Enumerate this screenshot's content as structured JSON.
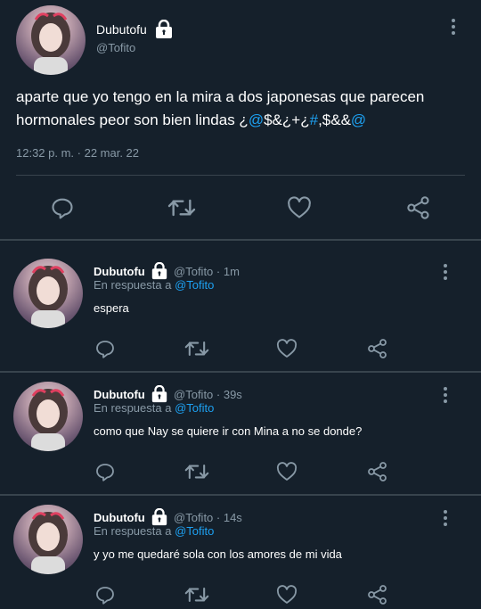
{
  "main_tweet": {
    "name": "Dubutofu",
    "handle": "@Tofito",
    "text_parts": [
      {
        "t": "aparte que yo tengo en la mira a dos japonesas que parecen hormonales peor son bien lindas ¿",
        "link": false
      },
      {
        "t": "@",
        "link": true
      },
      {
        "t": "$&¿+¿",
        "link": false
      },
      {
        "t": "#",
        "link": true
      },
      {
        "t": ",$&&",
        "link": false
      },
      {
        "t": "@",
        "link": true
      }
    ],
    "timestamp": "12:32 p. m. · 22 mar. 22"
  },
  "replies": [
    {
      "name": "Dubutofu",
      "handle_time": "@Tofito · 1m",
      "in_reply_label": "En respuesta a",
      "in_reply_to": "@Tofito",
      "text": "espera"
    },
    {
      "name": "Dubutofu",
      "handle_time": "@Tofito · 39s",
      "in_reply_label": "En respuesta a",
      "in_reply_to": "@Tofito",
      "text": "como que Nay se quiere ir con Mina a no se donde?"
    },
    {
      "name": "Dubutofu",
      "handle_time": "@Tofito · 14s",
      "in_reply_label": "En respuesta a",
      "in_reply_to": "@Tofito",
      "text": "y yo me quedaré sola con los amores de mi vida"
    }
  ],
  "icons": {
    "reply": "reply-icon",
    "retweet": "retweet-icon",
    "like": "heart-icon",
    "share": "share-icon",
    "more": "more-vertical-icon",
    "lock": "lock-icon"
  },
  "colors": {
    "background": "#15202b",
    "text": "#ffffff",
    "muted": "#8899a6",
    "link": "#1da1f2",
    "divider": "#38444d"
  }
}
